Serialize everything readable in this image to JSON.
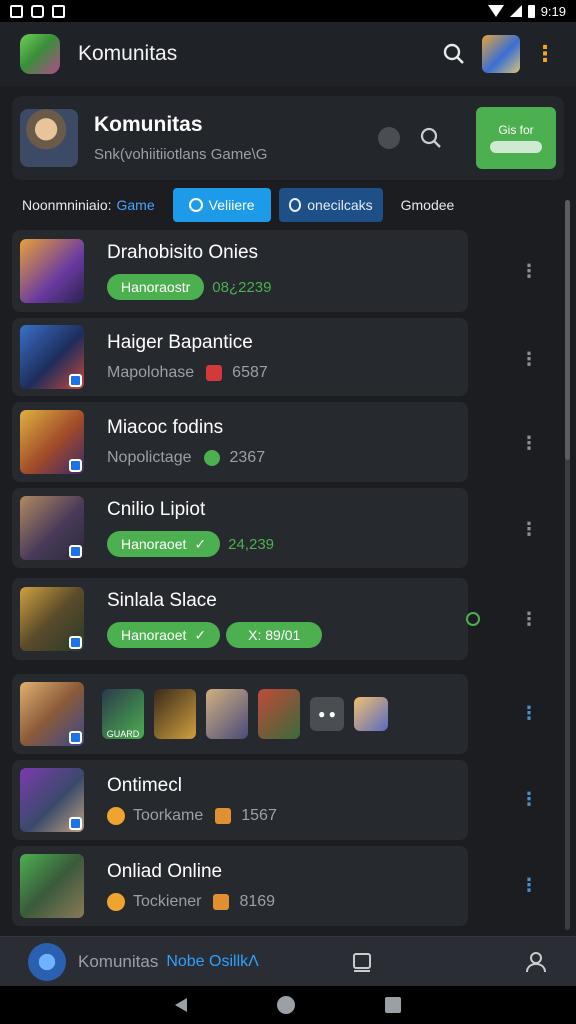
{
  "status_bar": {
    "time": "9:19"
  },
  "app_bar": {
    "title": "Komunitas",
    "logo": "game-logo",
    "search": "search-icon",
    "menu": "kebab-icon"
  },
  "community": {
    "title": "Komunitas",
    "subtitle": "Snk(vohiitiiotlans Game\\G",
    "join_label": "Gis for"
  },
  "tabs": {
    "label_prefix": "Noonmniniaio:",
    "label_highlight": "Game",
    "tab1": "Veliiere",
    "tab2": "onecilcaks",
    "tab3": "Gmodee"
  },
  "items": [
    {
      "title": "Drahobisito Onies",
      "pill": "Hanoraostr",
      "count": "08¿2239"
    },
    {
      "title": "Haiger Bapantice",
      "meta": "Mapolohase",
      "count": "6587"
    },
    {
      "title": "Miacoc fodins",
      "meta": "Nopolictage",
      "count": "2367"
    },
    {
      "title": "Cnilio Lipiot",
      "pill": "Hanoraoet",
      "count": "24,239"
    },
    {
      "title": "Sinlala Slace",
      "pill": "Hanoraoet",
      "pill2": "X: 89/01"
    },
    {
      "title": "Ontimecl",
      "meta": "Toorkame",
      "count": "1567"
    },
    {
      "title": "Onliad Online",
      "meta": "Tockiener",
      "count": "8169"
    }
  ],
  "mini_label": "GUARD",
  "bottom_nav": {
    "label": "Komunitas",
    "link": "Nobe OsillkΛ"
  },
  "colors": {
    "green": "#4caf50",
    "cyan": "#1e9be8",
    "navy": "#1e4f86",
    "bg": "#1b1d21",
    "card": "#26292e"
  }
}
